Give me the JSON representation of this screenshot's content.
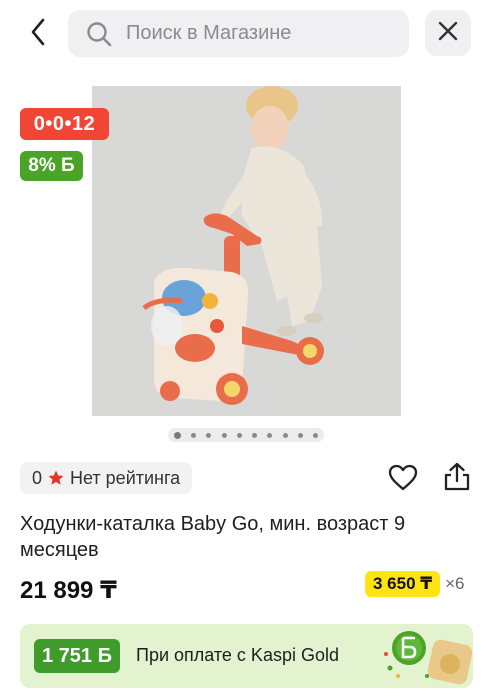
{
  "header": {
    "search_placeholder": "Поиск в Магазине",
    "back_icon": "chevron-left-icon",
    "search_icon": "search-icon",
    "close_icon": "close-icon"
  },
  "product": {
    "image_alt": "Ходунки-каталка Baby Go",
    "badges": {
      "timer": "0•0•12",
      "bonus": "8% Б"
    },
    "gallery": {
      "total": 10,
      "active": 1
    },
    "rating": {
      "count": "0",
      "label": "Нет рейтинга"
    },
    "title": "Ходунки-каталка Baby Go, мин. возраст 9 месяцев",
    "price": "21 899 ₸",
    "installment": {
      "amount": "3 650 ₸",
      "multiplier": "×6"
    }
  },
  "kaspi_gold": {
    "bonus": "1 751 Б",
    "text": "При оплате с Kaspi Gold"
  },
  "colors": {
    "timer_badge": "#f14635",
    "bonus_badge": "#4ba328",
    "installment_bg": "#ffe411",
    "kaspi_gold_bg": "#e3f2cf",
    "kaspi_badge": "#3f9c2b"
  }
}
